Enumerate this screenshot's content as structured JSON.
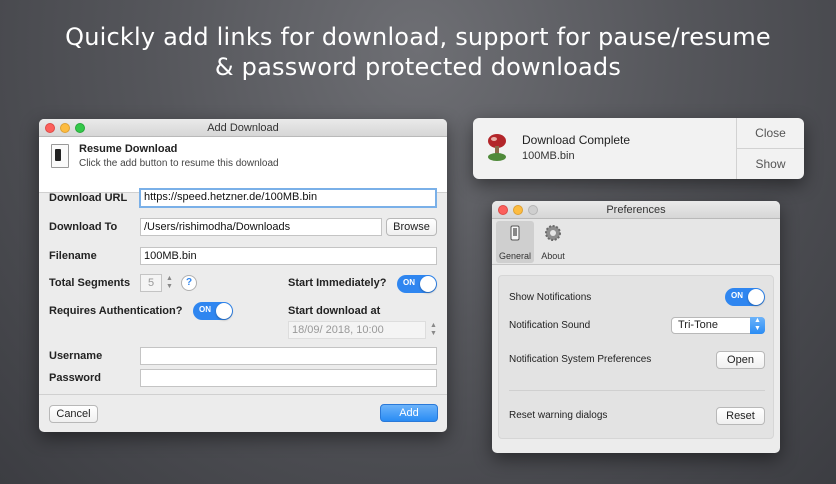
{
  "headline": {
    "line1": "Quickly add links for download, support for pause/resume",
    "line2": "& password protected downloads"
  },
  "add_download": {
    "title": "Add Download",
    "header_title": "Resume Download",
    "header_subtitle": "Click the add button to resume this download",
    "url_label": "Download URL",
    "url_value": "https://speed.hetzner.de/100MB.bin",
    "to_label": "Download To",
    "to_value": "/Users/rishimodha/Downloads",
    "browse_label": "Browse",
    "filename_label": "Filename",
    "filename_value": "100MB.bin",
    "segments_label": "Total Segments",
    "segments_value": "5",
    "help_label": "?",
    "start_immediately_label": "Start Immediately?",
    "start_immediately_toggle": "ON",
    "auth_label": "Requires Authentication?",
    "auth_toggle": "ON",
    "start_at_label": "Start download at",
    "start_at_value": "18/09/ 2018, 10:00",
    "username_label": "Username",
    "username_value": "",
    "password_label": "Password",
    "password_value": "",
    "cancel_label": "Cancel",
    "add_label": "Add"
  },
  "notification": {
    "title": "Download Complete",
    "subtitle": "100MB.bin",
    "close_label": "Close",
    "show_label": "Show"
  },
  "preferences": {
    "title": "Preferences",
    "tabs": [
      {
        "label": "General",
        "icon": "phone-icon"
      },
      {
        "label": "About",
        "icon": "gear-icon"
      }
    ],
    "show_notifications_label": "Show Notifications",
    "show_notifications_toggle": "ON",
    "notification_sound_label": "Notification Sound",
    "notification_sound_value": "Tri-Tone",
    "system_prefs_label": "Notification System Preferences",
    "open_label": "Open",
    "reset_warning_label": "Reset warning dialogs",
    "reset_label": "Reset"
  },
  "colors": {
    "accent": "#2f86f0",
    "traffic_red": "#fc605c",
    "traffic_yellow": "#fdbc40",
    "traffic_green": "#34c84a"
  }
}
